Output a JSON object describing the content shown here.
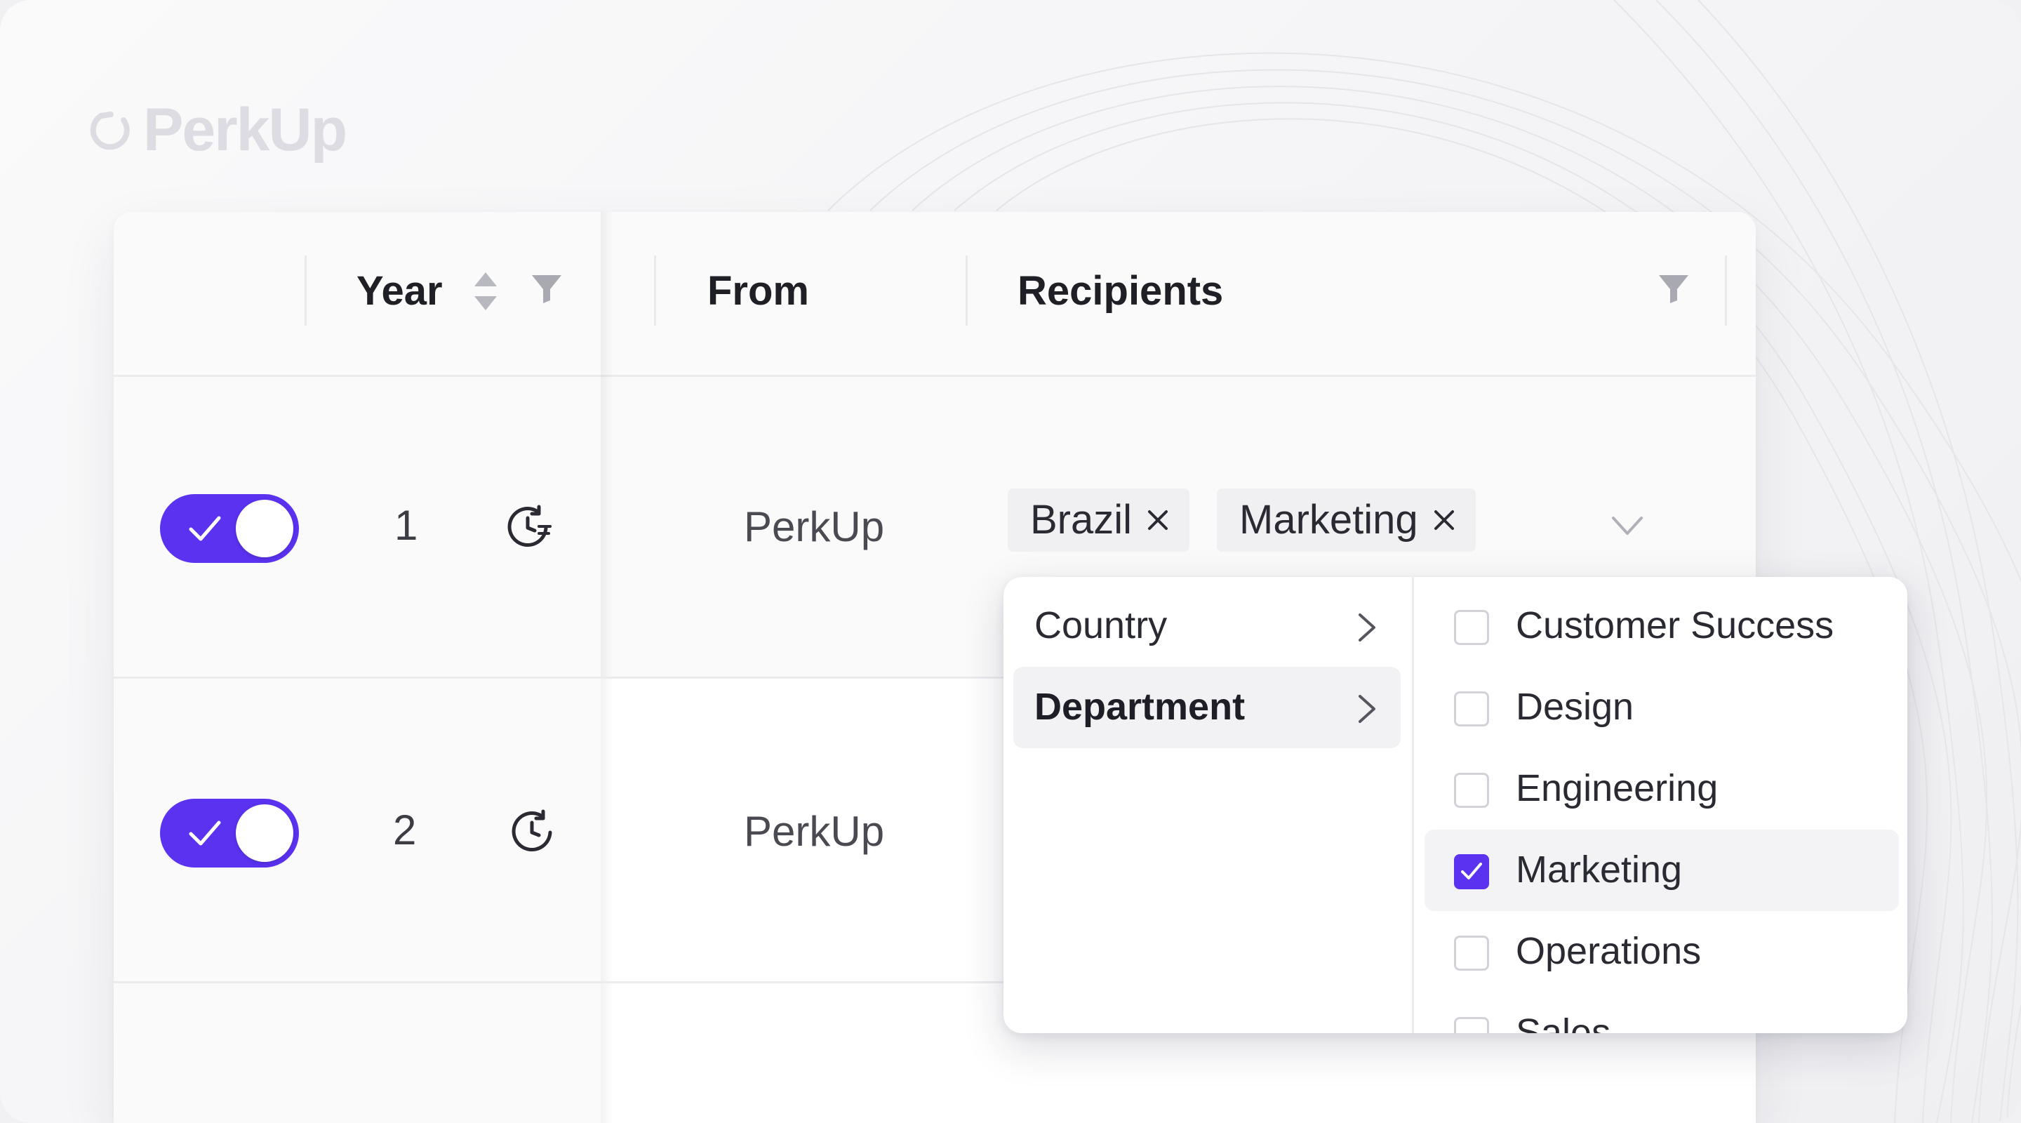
{
  "brand": {
    "name": "PerkUp"
  },
  "colors": {
    "accent": "#5a32f0",
    "text": "#1f1f26",
    "muted": "#4a4a52"
  },
  "table": {
    "columns": {
      "year": "Year",
      "from": "From",
      "recipients": "Recipients"
    },
    "rows": [
      {
        "enabled": true,
        "year": "1",
        "from": "PerkUp",
        "icon": "clock-repeat-icon"
      },
      {
        "enabled": true,
        "year": "2",
        "from": "PerkUp",
        "icon": "clock-repeat-icon"
      }
    ]
  },
  "recipients_select": {
    "tags": [
      {
        "label": "Brazil"
      },
      {
        "label": "Marketing"
      }
    ]
  },
  "cascader": {
    "categories": [
      {
        "label": "Country",
        "active": false
      },
      {
        "label": "Department",
        "active": true
      }
    ],
    "options": [
      {
        "label": "Customer Success",
        "checked": false
      },
      {
        "label": "Design",
        "checked": false
      },
      {
        "label": "Engineering",
        "checked": false
      },
      {
        "label": "Marketing",
        "checked": true
      },
      {
        "label": "Operations",
        "checked": false
      },
      {
        "label": "Sales",
        "checked": false
      }
    ]
  }
}
